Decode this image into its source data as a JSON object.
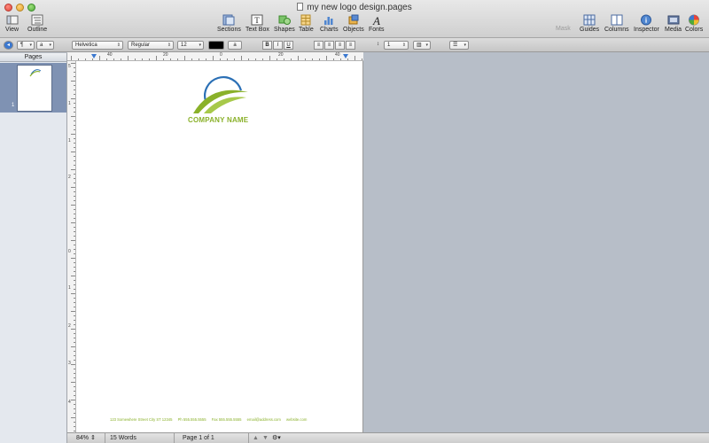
{
  "window": {
    "title": "my new logo design.pages"
  },
  "toolbar": {
    "view": "View",
    "outline": "Outline",
    "sections": "Sections",
    "textbox": "Text Box",
    "shapes": "Shapes",
    "table": "Table",
    "charts": "Charts",
    "objects": "Objects",
    "fonts": "Fonts",
    "mask": "Mask",
    "guides": "Guides",
    "columns": "Columns",
    "inspector": "Inspector",
    "media": "Media",
    "colors": "Colors"
  },
  "format": {
    "paragraph_style": "¶",
    "char_style": "a",
    "font": "Helvetica",
    "weight": "Regular",
    "size": "12",
    "text_color": "#000000",
    "highlight_label": "a",
    "bold": "B",
    "italic": "I",
    "underline": "U",
    "line_spacing_value": "1"
  },
  "sidebar": {
    "header": "Pages",
    "thumb_number": "1"
  },
  "ruler": {
    "h_labels": [
      "40",
      "20",
      "0",
      "20",
      "40"
    ],
    "v_labels": [
      "5",
      "1",
      "1",
      "2",
      "0",
      "1",
      "2",
      "3",
      "4"
    ]
  },
  "document": {
    "company_name": "COMPANY NAME",
    "footer": {
      "address": "123 Somewhere Street City ST 12345",
      "phone": "Ph 555.555.5555",
      "fax": "Fax 555.555.5555",
      "email": "email@address.com",
      "website": "website.com"
    },
    "brand_green": "#8ab12a",
    "brand_blue": "#2a6fb5"
  },
  "status": {
    "zoom": "84%",
    "words": "15 Words",
    "page": "Page 1 of 1"
  }
}
